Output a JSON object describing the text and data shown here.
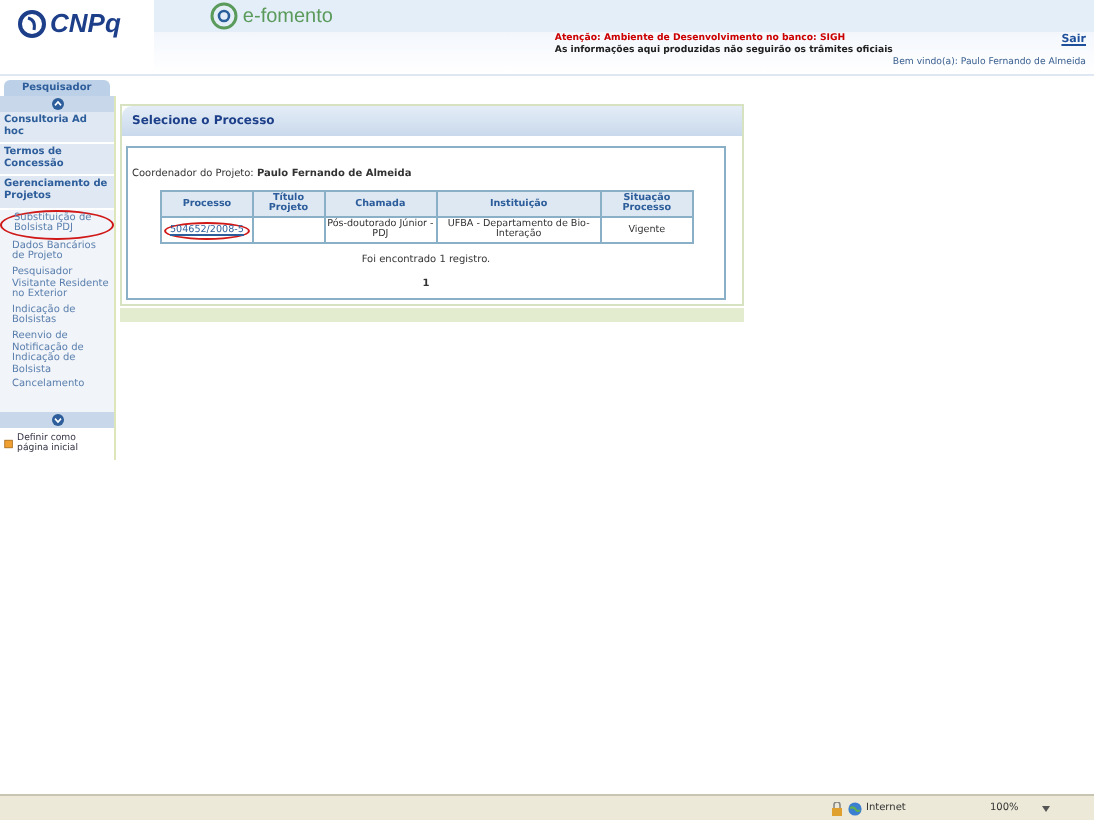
{
  "header": {
    "logo": "CNPq",
    "app_logo": "e-fomento",
    "warning": "Atenção: Ambiente de Desenvolvimento no banco: SIGH",
    "notice": "As informações aqui produzidas não seguirão os trâmites oficiais",
    "logout": "Sair",
    "welcome": "Bem vindo(a): Paulo Fernando de Almeida"
  },
  "tabs": [
    {
      "label": "Pesquisador",
      "selected": true
    }
  ],
  "sidebar": {
    "items": [
      {
        "label": "Consultoria Ad hoc",
        "kind": "section",
        "circled": false
      },
      {
        "label": "Termos de Concessão",
        "kind": "section",
        "circled": false
      },
      {
        "label": "Gerenciamento de Projetos",
        "kind": "section",
        "circled": false
      },
      {
        "label": "Substituição de Bolsista PDJ",
        "kind": "link",
        "circled": true
      },
      {
        "label": "Dados Bancários de Projeto",
        "kind": "link",
        "circled": false
      },
      {
        "label": "Pesquisador Visitante Residente no Exterior",
        "kind": "link",
        "circled": false
      },
      {
        "label": "Indicação de Bolsistas",
        "kind": "link",
        "circled": false
      },
      {
        "label": "Reenvio de Notificação de Indicação de Bolsista",
        "kind": "link",
        "circled": false
      },
      {
        "label": "Cancelamento",
        "kind": "link",
        "circled": false
      }
    ],
    "homepage_link": "Definir como página inicial"
  },
  "panel": {
    "title": "Selecione o Processo",
    "coordinator_label": "Coordenador do Projeto:",
    "coordinator": "Paulo Fernando de Almeida",
    "table": {
      "columns": [
        "Processo",
        "Título Projeto",
        "Chamada",
        "Instituição",
        "Situação Processo"
      ],
      "rows": [
        {
          "processo": "504652/2008-5",
          "circled": true,
          "chamada": "Pós-doutorado Júnior - PDJ",
          "instituicao": "UFBA - Departamento de Bio-Interação",
          "situacao": "Vigente"
        }
      ]
    },
    "result": "Foi encontrado 1 registro.",
    "page": "1"
  },
  "status_bar": {
    "zone": "Internet",
    "zoom": "100%"
  }
}
